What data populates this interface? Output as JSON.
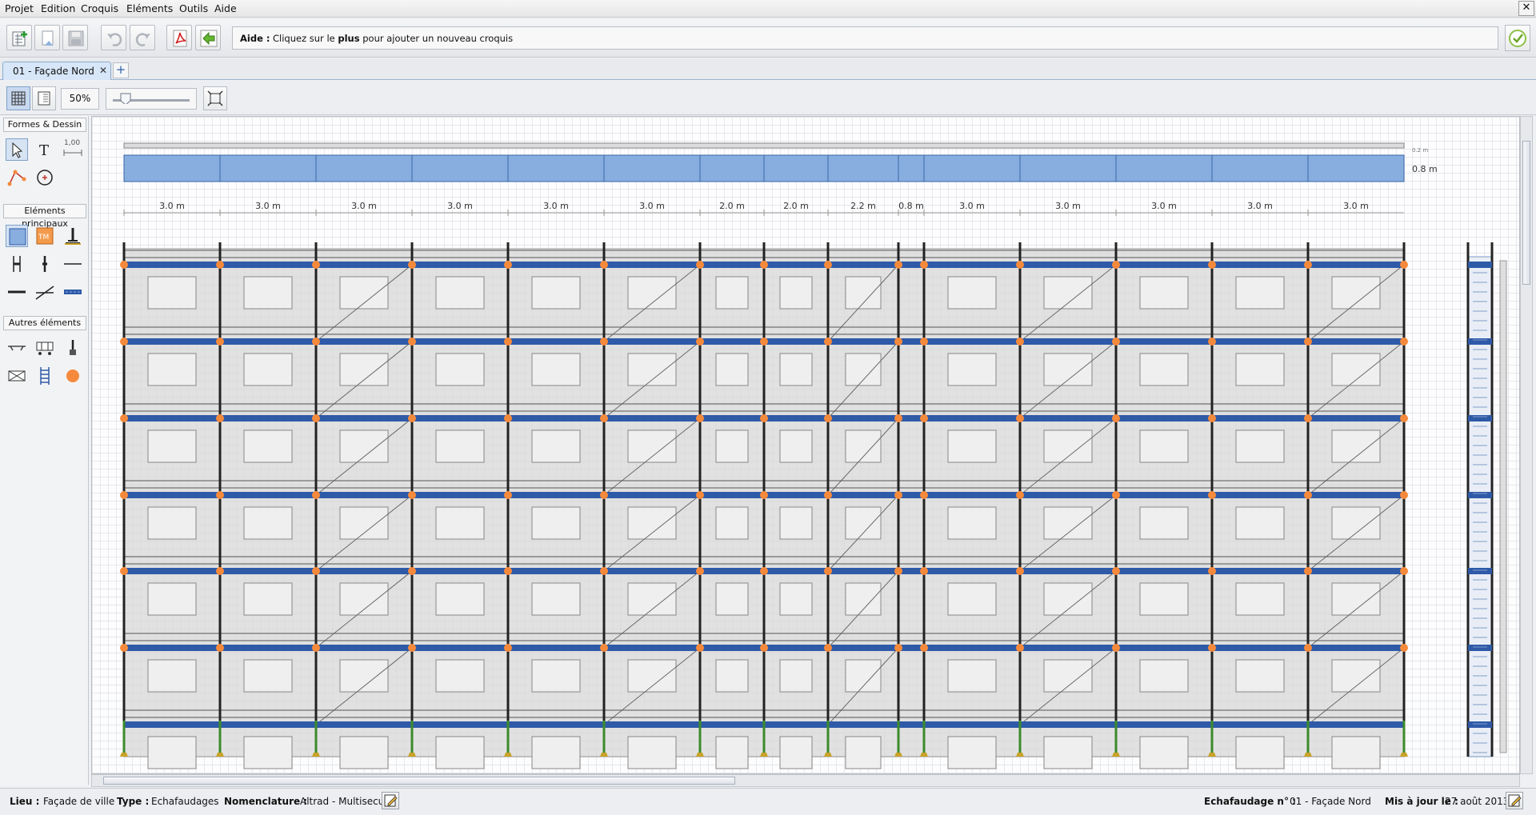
{
  "menu": [
    "Projet",
    "Edition",
    "Croquis",
    "Eléments",
    "Outils",
    "Aide"
  ],
  "window": {
    "close_glyph": "✕"
  },
  "toolbar": {
    "help_label": "Aide :",
    "help_text_pre": "Cliquez sur le",
    "help_text_bold": "plus",
    "help_text_post": "pour ajouter un nouveau croquis",
    "buttons": [
      "new-project-icon",
      "open-icon",
      "save-icon",
      "undo-icon",
      "redo-icon",
      "pdf-icon",
      "back-arrow-icon"
    ],
    "validate_icon": "check-icon"
  },
  "tabs": [
    {
      "label": "01 - Façade Nord",
      "close": "✕"
    }
  ],
  "tab_add": "+",
  "view": {
    "zoom": "50%",
    "zoom_level": 0.2
  },
  "palette": {
    "sections": [
      "Formes & Dessin",
      "Eléments principaux",
      "Autres éléments"
    ],
    "measure_label": "1,00"
  },
  "drawing": {
    "bay_widths": [
      "3.0 m",
      "3.0 m",
      "3.0 m",
      "3.0 m",
      "3.0 m",
      "3.0 m",
      "2.0 m",
      "2.0 m",
      "2.2 m",
      "0.8 m",
      "3.0 m",
      "3.0 m",
      "3.0 m",
      "3.0 m",
      "3.0 m"
    ],
    "depth_label": "0.8 m",
    "top_label": "0.2 m",
    "levels": 7,
    "colors": {
      "deck": "#2e5aa8",
      "plan": "#88aee0",
      "node": "#f58a3c",
      "standard": "#222222",
      "base": "#3d8c2a"
    }
  },
  "status": {
    "lieu_label": "Lieu :",
    "lieu": "Façade de ville",
    "type_label": "Type :",
    "type": "Echafaudages",
    "nomenclature_label": "Nomenclature :",
    "nomenclature": "Altrad - Multisecu",
    "echafaudage_label": "Echafaudage n° :",
    "echafaudage": "01 - Façade Nord",
    "maj_label": "Mis à jour le :",
    "maj": "27 août 2013"
  }
}
